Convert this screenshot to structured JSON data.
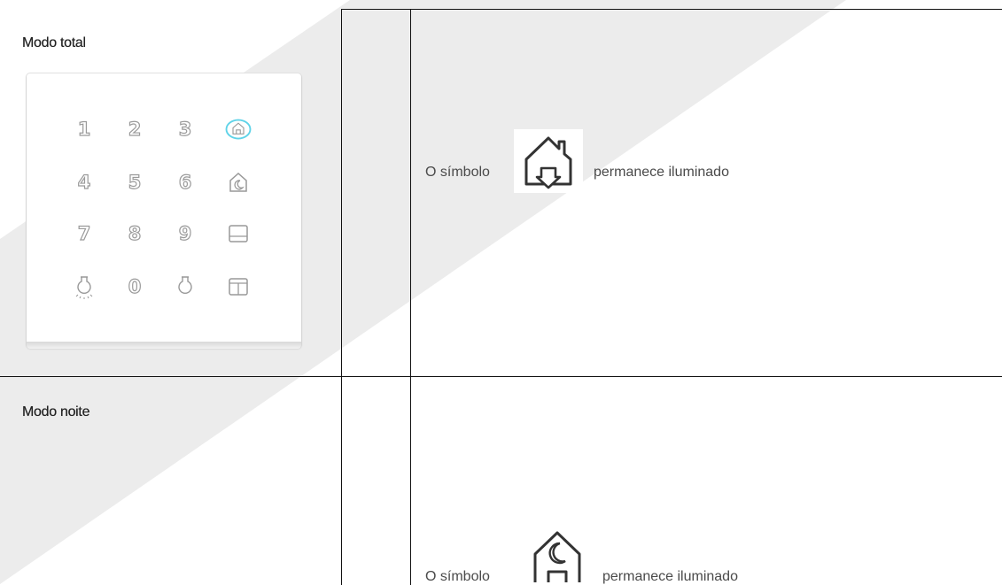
{
  "rows": [
    {
      "mode_label": "Modo total",
      "desc_prefix": "O símbolo",
      "desc_suffix": "permanece iluminado",
      "icon": "house-arrow-down-icon"
    },
    {
      "mode_label": "Modo noite",
      "desc_prefix": "O símbolo",
      "desc_suffix": "permanece iluminado",
      "icon": "house-moon-icon"
    }
  ],
  "keypad": {
    "digits": [
      "1",
      "2",
      "3",
      "4",
      "5",
      "6",
      "7",
      "8",
      "9",
      "0"
    ],
    "highlight_color": "#5fd3e8",
    "icons": [
      "home-icon",
      "home-night-icon",
      "keyboard-icon",
      "panel-icon",
      "bulb-on-icon",
      "bulb-off-icon"
    ]
  },
  "colors": {
    "border": "#111111",
    "watermark": "#ececec",
    "key_stroke": "#9a9a9a"
  }
}
